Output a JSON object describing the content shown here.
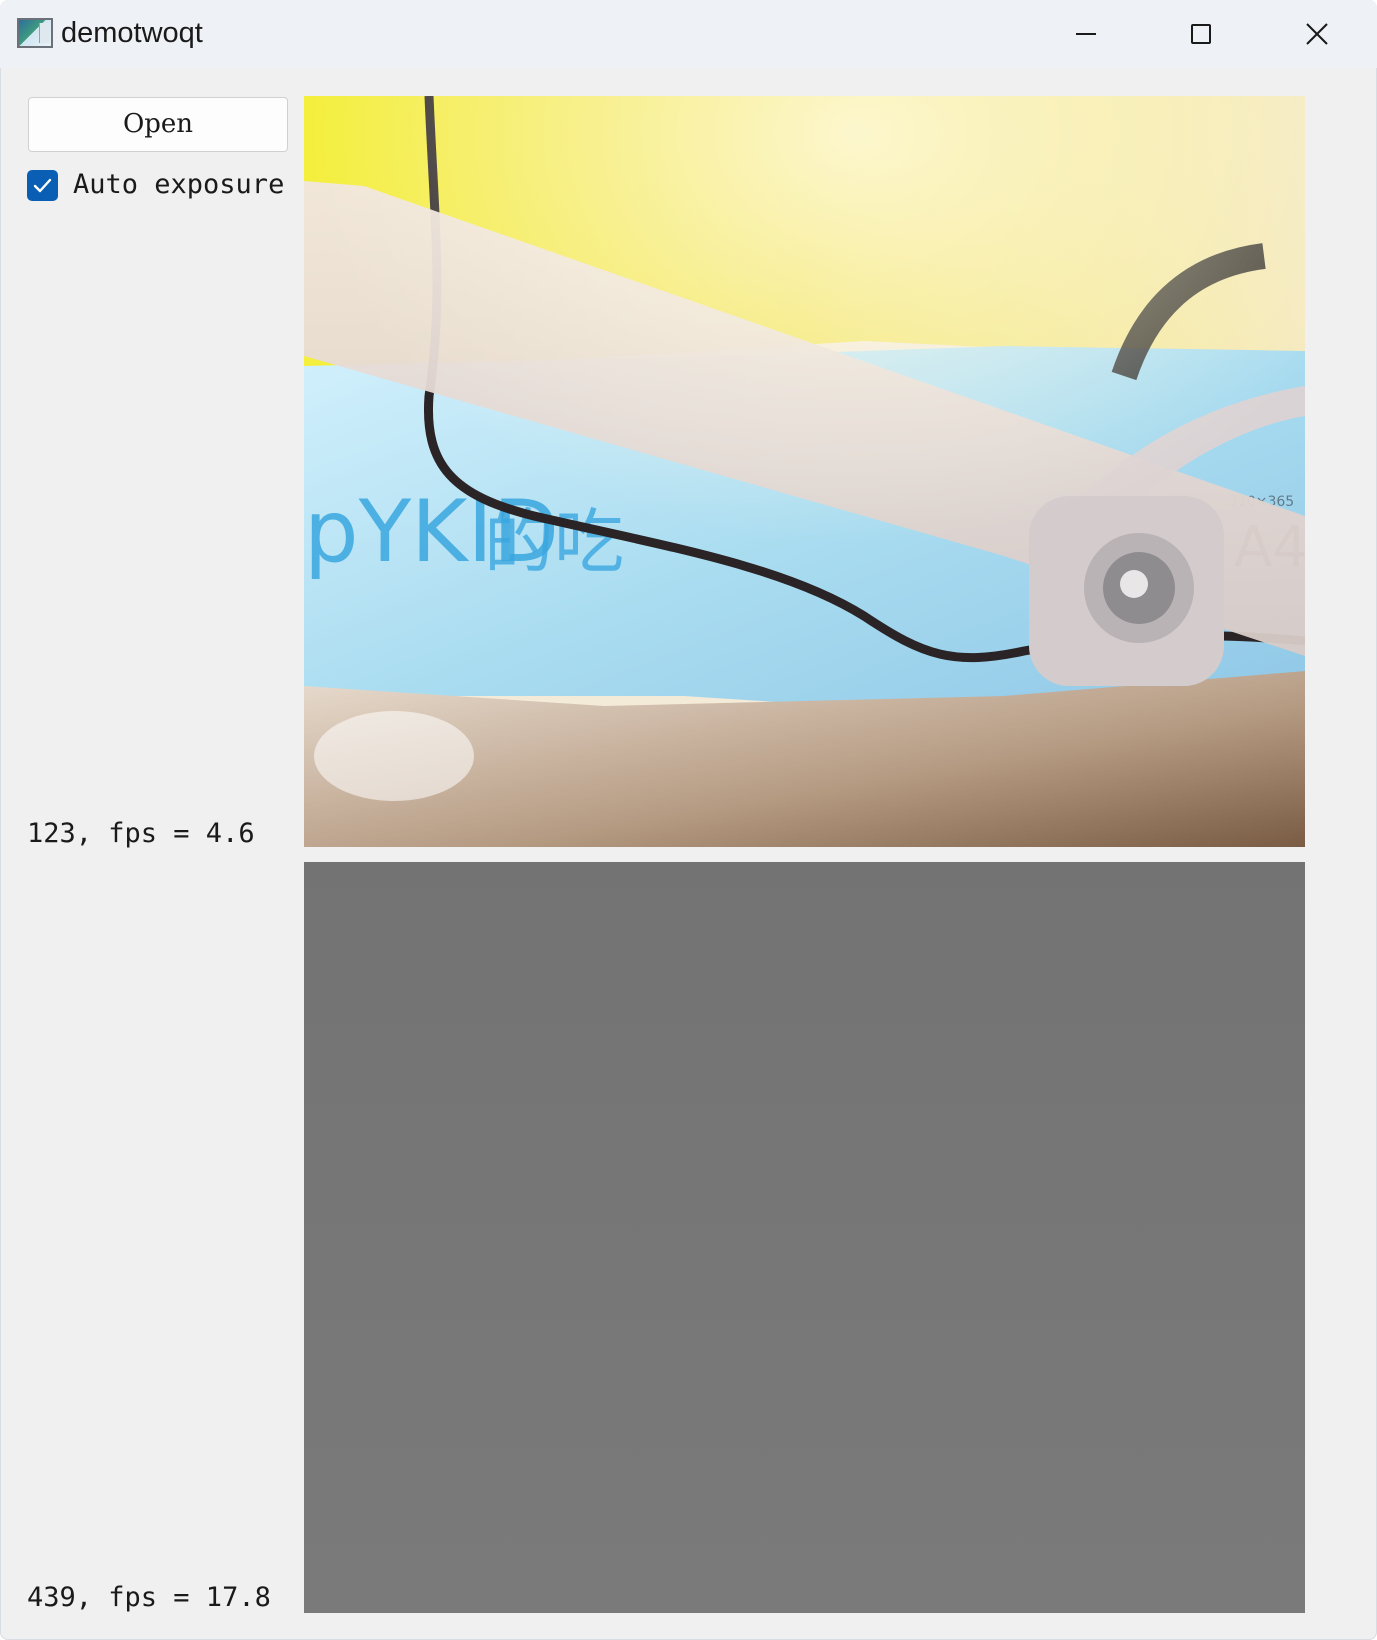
{
  "window": {
    "title": "demotwoqt",
    "icon": "app-window-icon",
    "controls": [
      "minimize-icon",
      "maximize-icon",
      "close-icon"
    ]
  },
  "controls": {
    "open_label": "Open",
    "auto_exposure": {
      "label": "Auto exposure",
      "checked": true,
      "accent_color": "#0a5fb5"
    }
  },
  "camera_1": {
    "status": "123, fps = 4.6",
    "feed": "color camera image"
  },
  "camera_2": {
    "status": "439, fps = 17.8",
    "feed": "gray camera image"
  }
}
